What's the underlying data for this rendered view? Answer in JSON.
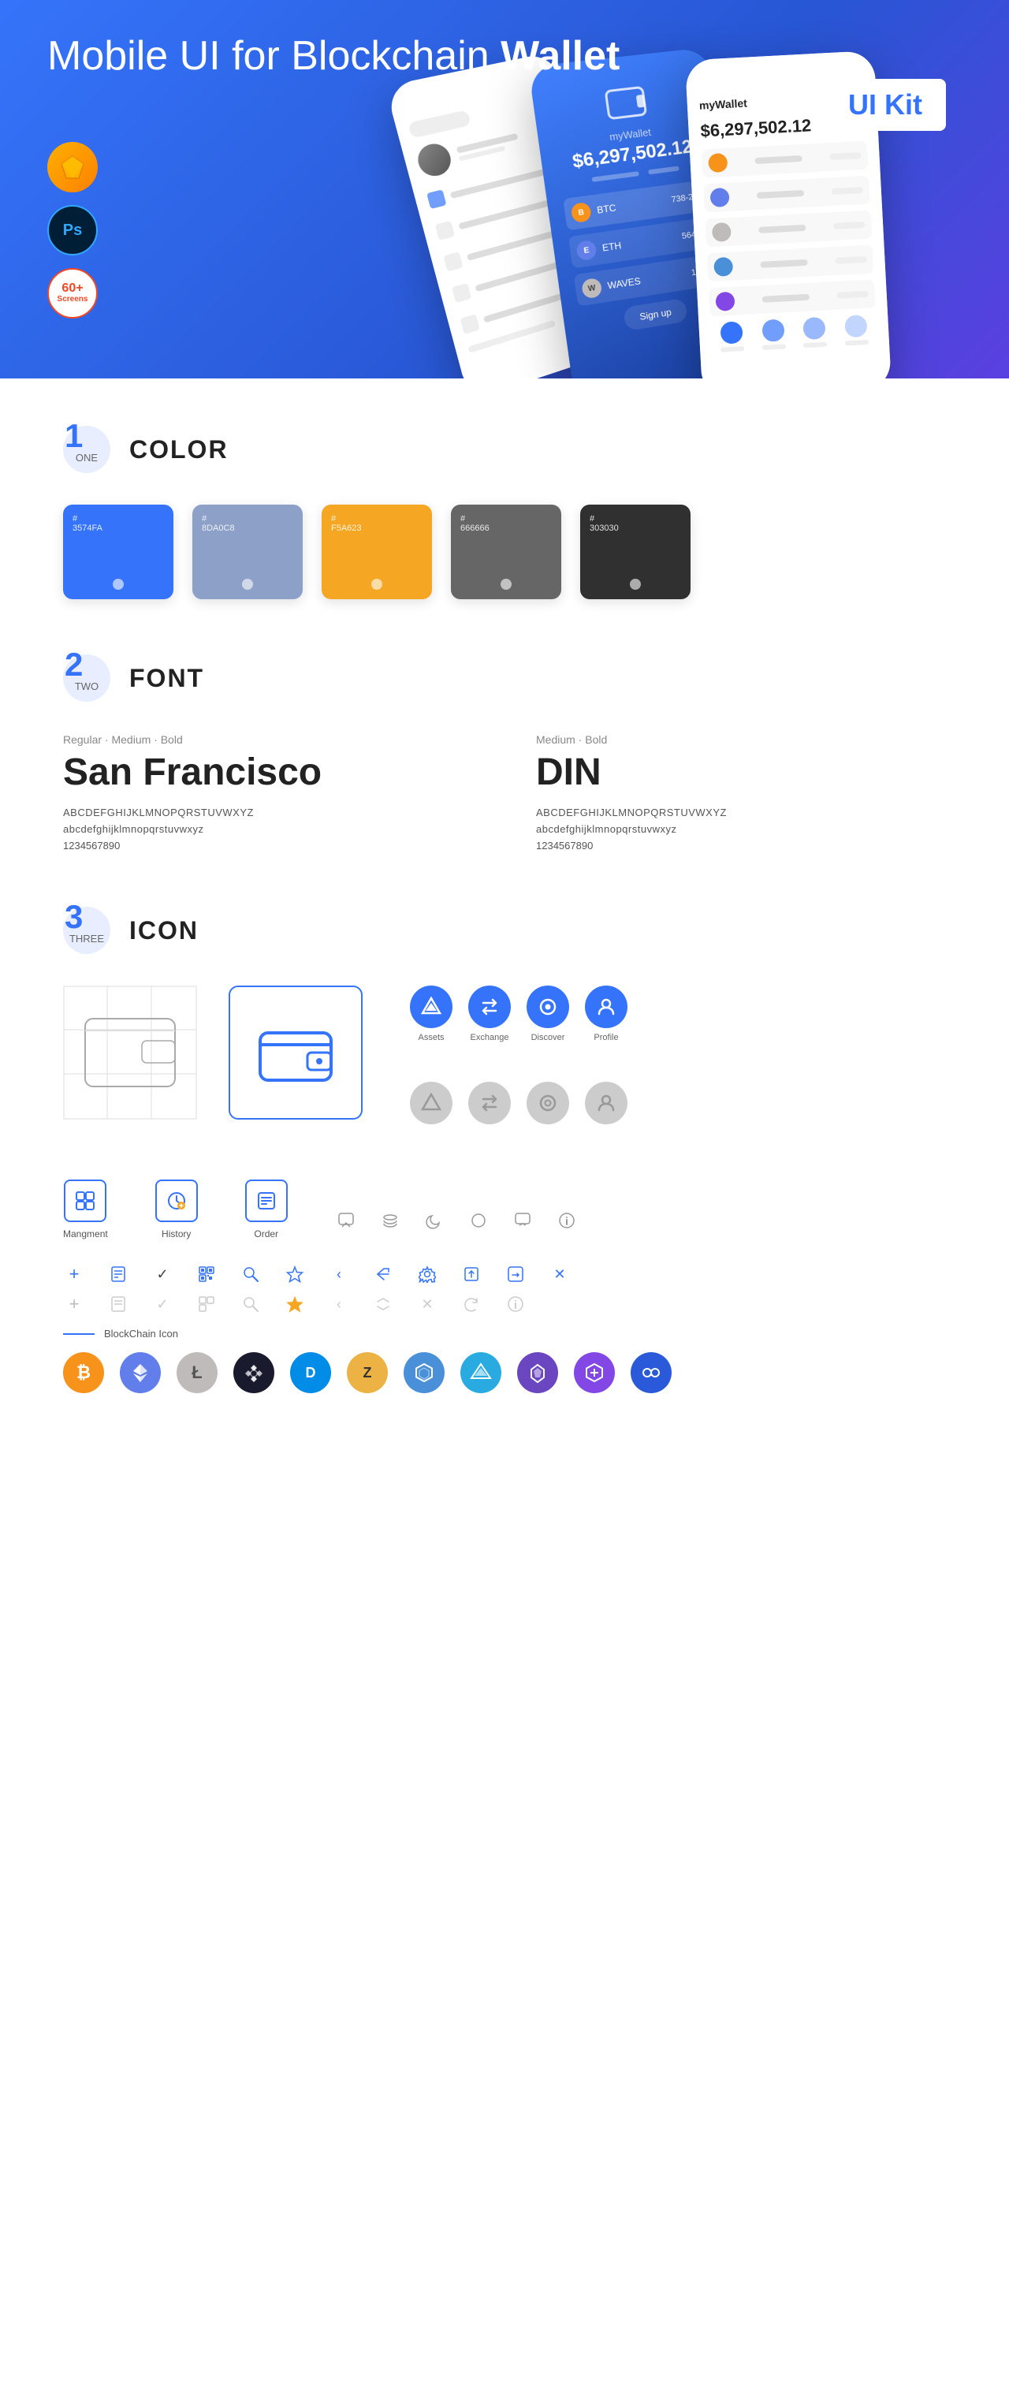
{
  "hero": {
    "title_regular": "Mobile UI for Blockchain ",
    "title_bold": "Wallet",
    "badge": "UI Kit",
    "badge_sub": "UI Kit"
  },
  "badges": [
    {
      "id": "sketch",
      "label": "S",
      "type": "sketch"
    },
    {
      "id": "ps",
      "label": "Ps",
      "type": "ps"
    },
    {
      "id": "screens",
      "line1": "60+",
      "line2": "Screens",
      "type": "screens"
    }
  ],
  "section1": {
    "num": "1",
    "sub": "ONE",
    "title": "COLOR",
    "colors": [
      {
        "hex": "#3574FA",
        "label": "#3574FA",
        "name": "3574FA"
      },
      {
        "hex": "#8DA0C8",
        "label": "#8DA0C8",
        "name": "8DA0C8"
      },
      {
        "hex": "#F5A623",
        "label": "#F5A623",
        "name": "F5A623"
      },
      {
        "hex": "#666666",
        "label": "#666666",
        "name": "666666"
      },
      {
        "hex": "#303030",
        "label": "#303030",
        "name": "303030"
      }
    ]
  },
  "section2": {
    "num": "2",
    "sub": "TWO",
    "title": "FONT",
    "font1": {
      "weights": "Regular · Medium · Bold",
      "name": "San Francisco",
      "upper": "ABCDEFGHIJKLMNOPQRSTUVWXYZ",
      "lower": "abcdefghijklmnopqrstuvwxyz",
      "nums": "1234567890"
    },
    "font2": {
      "weights": "Medium · Bold",
      "name": "DIN",
      "upper": "ABCDEFGHIJKLMNOPQRSTUVWXYZ",
      "lower": "abcdefghijklmnopqrstuvwxyz",
      "nums": "1234567890"
    }
  },
  "section3": {
    "num": "3",
    "sub": "THREE",
    "title": "ICON",
    "nav_icons": [
      {
        "id": "assets",
        "label": "Assets"
      },
      {
        "id": "exchange",
        "label": "Exchange"
      },
      {
        "id": "discover",
        "label": "Discover"
      },
      {
        "id": "profile",
        "label": "Profile"
      }
    ],
    "app_icons": [
      {
        "id": "management",
        "label": "Mangment"
      },
      {
        "id": "history",
        "label": "History"
      },
      {
        "id": "order",
        "label": "Order"
      }
    ],
    "blockchain_label": "BlockChain Icon",
    "crypto_icons": [
      {
        "id": "btc",
        "symbol": "₿"
      },
      {
        "id": "eth",
        "symbol": "⟠"
      },
      {
        "id": "ltc",
        "symbol": "Ł"
      },
      {
        "id": "bnb",
        "symbol": "◆"
      },
      {
        "id": "dash",
        "symbol": "D"
      },
      {
        "id": "zec",
        "symbol": "Z"
      },
      {
        "id": "hex",
        "symbol": "⬡"
      },
      {
        "id": "sky",
        "symbol": "▲"
      },
      {
        "id": "arw",
        "symbol": "◈"
      },
      {
        "id": "matic",
        "symbol": "⬟"
      },
      {
        "id": "lnk",
        "symbol": "∞"
      }
    ]
  }
}
